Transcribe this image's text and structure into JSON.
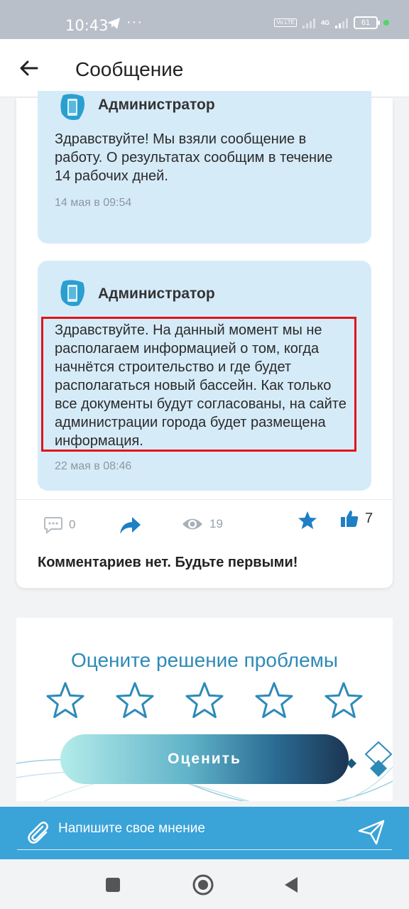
{
  "status_bar": {
    "time": "10:43",
    "battery": "61",
    "network": "4G",
    "volte": "Vo LTE"
  },
  "header": {
    "title": "Сообщение"
  },
  "messages": [
    {
      "author": "Администратор",
      "text": "Здравствуйте! Мы взяли сообщение в работу. О результатах сообщим в течение 14 рабочих дней.",
      "date": "14 мая в 09:54"
    },
    {
      "author": "Администратор",
      "text": "Здравствуйте. На данный момент мы не располагаем информацией о том, когда начнётся строительство и где будет располагаться новый бассейн. Как только все документы будут согласованы, на сайте администрации города будет размещена информация.",
      "date": "22 мая в 08:46"
    }
  ],
  "actions": {
    "comments_count": "0",
    "views_count": "19",
    "likes_count": "7"
  },
  "no_comments": "Комментариев нет. Будьте первыми!",
  "rating": {
    "title": "Оцените решение проблемы",
    "button": "Оценить",
    "stars_selected": 0,
    "stars_total": 5
  },
  "comment_bar": {
    "placeholder": "Напишите свое мнение"
  },
  "colors": {
    "accent": "#3aa3d8",
    "bubble": "#d6ebf8",
    "star": "#2d8ab8",
    "like": "#1e7fc4",
    "highlight": "#e0151b"
  }
}
